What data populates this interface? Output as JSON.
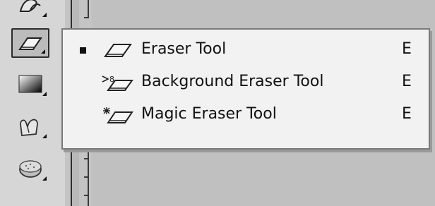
{
  "toolbar": {
    "tools": [
      {
        "name": "blur-tool",
        "icon": "blur-icon"
      },
      {
        "name": "eraser-tool",
        "icon": "eraser-icon",
        "active": true
      },
      {
        "name": "gradient-tool",
        "icon": "gradient-icon"
      },
      {
        "name": "smudge-tool",
        "icon": "smudge-icon"
      },
      {
        "name": "sponge-tool",
        "icon": "sponge-icon"
      }
    ]
  },
  "flyout": {
    "items": [
      {
        "label": "Eraser Tool",
        "shortcut": "E",
        "selected": true,
        "icon": "eraser-icon"
      },
      {
        "label": "Background Eraser Tool",
        "shortcut": "E",
        "selected": false,
        "icon": "background-eraser-icon"
      },
      {
        "label": "Magic Eraser Tool",
        "shortcut": "E",
        "selected": false,
        "icon": "magic-eraser-icon"
      }
    ]
  }
}
